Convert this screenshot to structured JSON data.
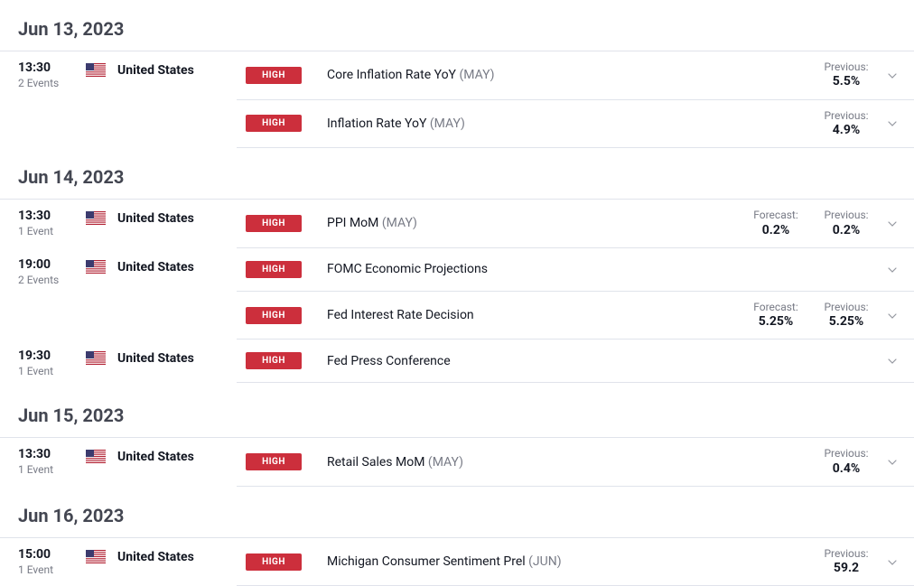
{
  "labels": {
    "forecast": "Forecast:",
    "previous": "Previous:",
    "events_singular": "Event",
    "events_plural": "Events"
  },
  "impact_high": "HIGH",
  "country": "United States",
  "days": [
    {
      "date": "Jun 13, 2023",
      "groups": [
        {
          "time": "13:30",
          "event_count": 2,
          "events": [
            {
              "name": "Core Inflation Rate YoY",
              "period": "(MAY)",
              "forecast": null,
              "previous": "5.5%"
            },
            {
              "name": "Inflation Rate YoY",
              "period": "(MAY)",
              "forecast": null,
              "previous": "4.9%"
            }
          ]
        }
      ]
    },
    {
      "date": "Jun 14, 2023",
      "groups": [
        {
          "time": "13:30",
          "event_count": 1,
          "events": [
            {
              "name": "PPI MoM",
              "period": "(MAY)",
              "forecast": "0.2%",
              "previous": "0.2%"
            }
          ]
        },
        {
          "time": "19:00",
          "event_count": 2,
          "events": [
            {
              "name": "FOMC Economic Projections",
              "period": "",
              "forecast": null,
              "previous": null
            },
            {
              "name": "Fed Interest Rate Decision",
              "period": "",
              "forecast": "5.25%",
              "previous": "5.25%"
            }
          ]
        },
        {
          "time": "19:30",
          "event_count": 1,
          "events": [
            {
              "name": "Fed Press Conference",
              "period": "",
              "forecast": null,
              "previous": null
            }
          ]
        }
      ]
    },
    {
      "date": "Jun 15, 2023",
      "groups": [
        {
          "time": "13:30",
          "event_count": 1,
          "events": [
            {
              "name": "Retail Sales MoM",
              "period": "(MAY)",
              "forecast": null,
              "previous": "0.4%"
            }
          ]
        }
      ]
    },
    {
      "date": "Jun 16, 2023",
      "groups": [
        {
          "time": "15:00",
          "event_count": 1,
          "events": [
            {
              "name": "Michigan Consumer Sentiment Prel",
              "period": "(JUN)",
              "forecast": null,
              "previous": "59.2"
            }
          ]
        }
      ]
    }
  ]
}
